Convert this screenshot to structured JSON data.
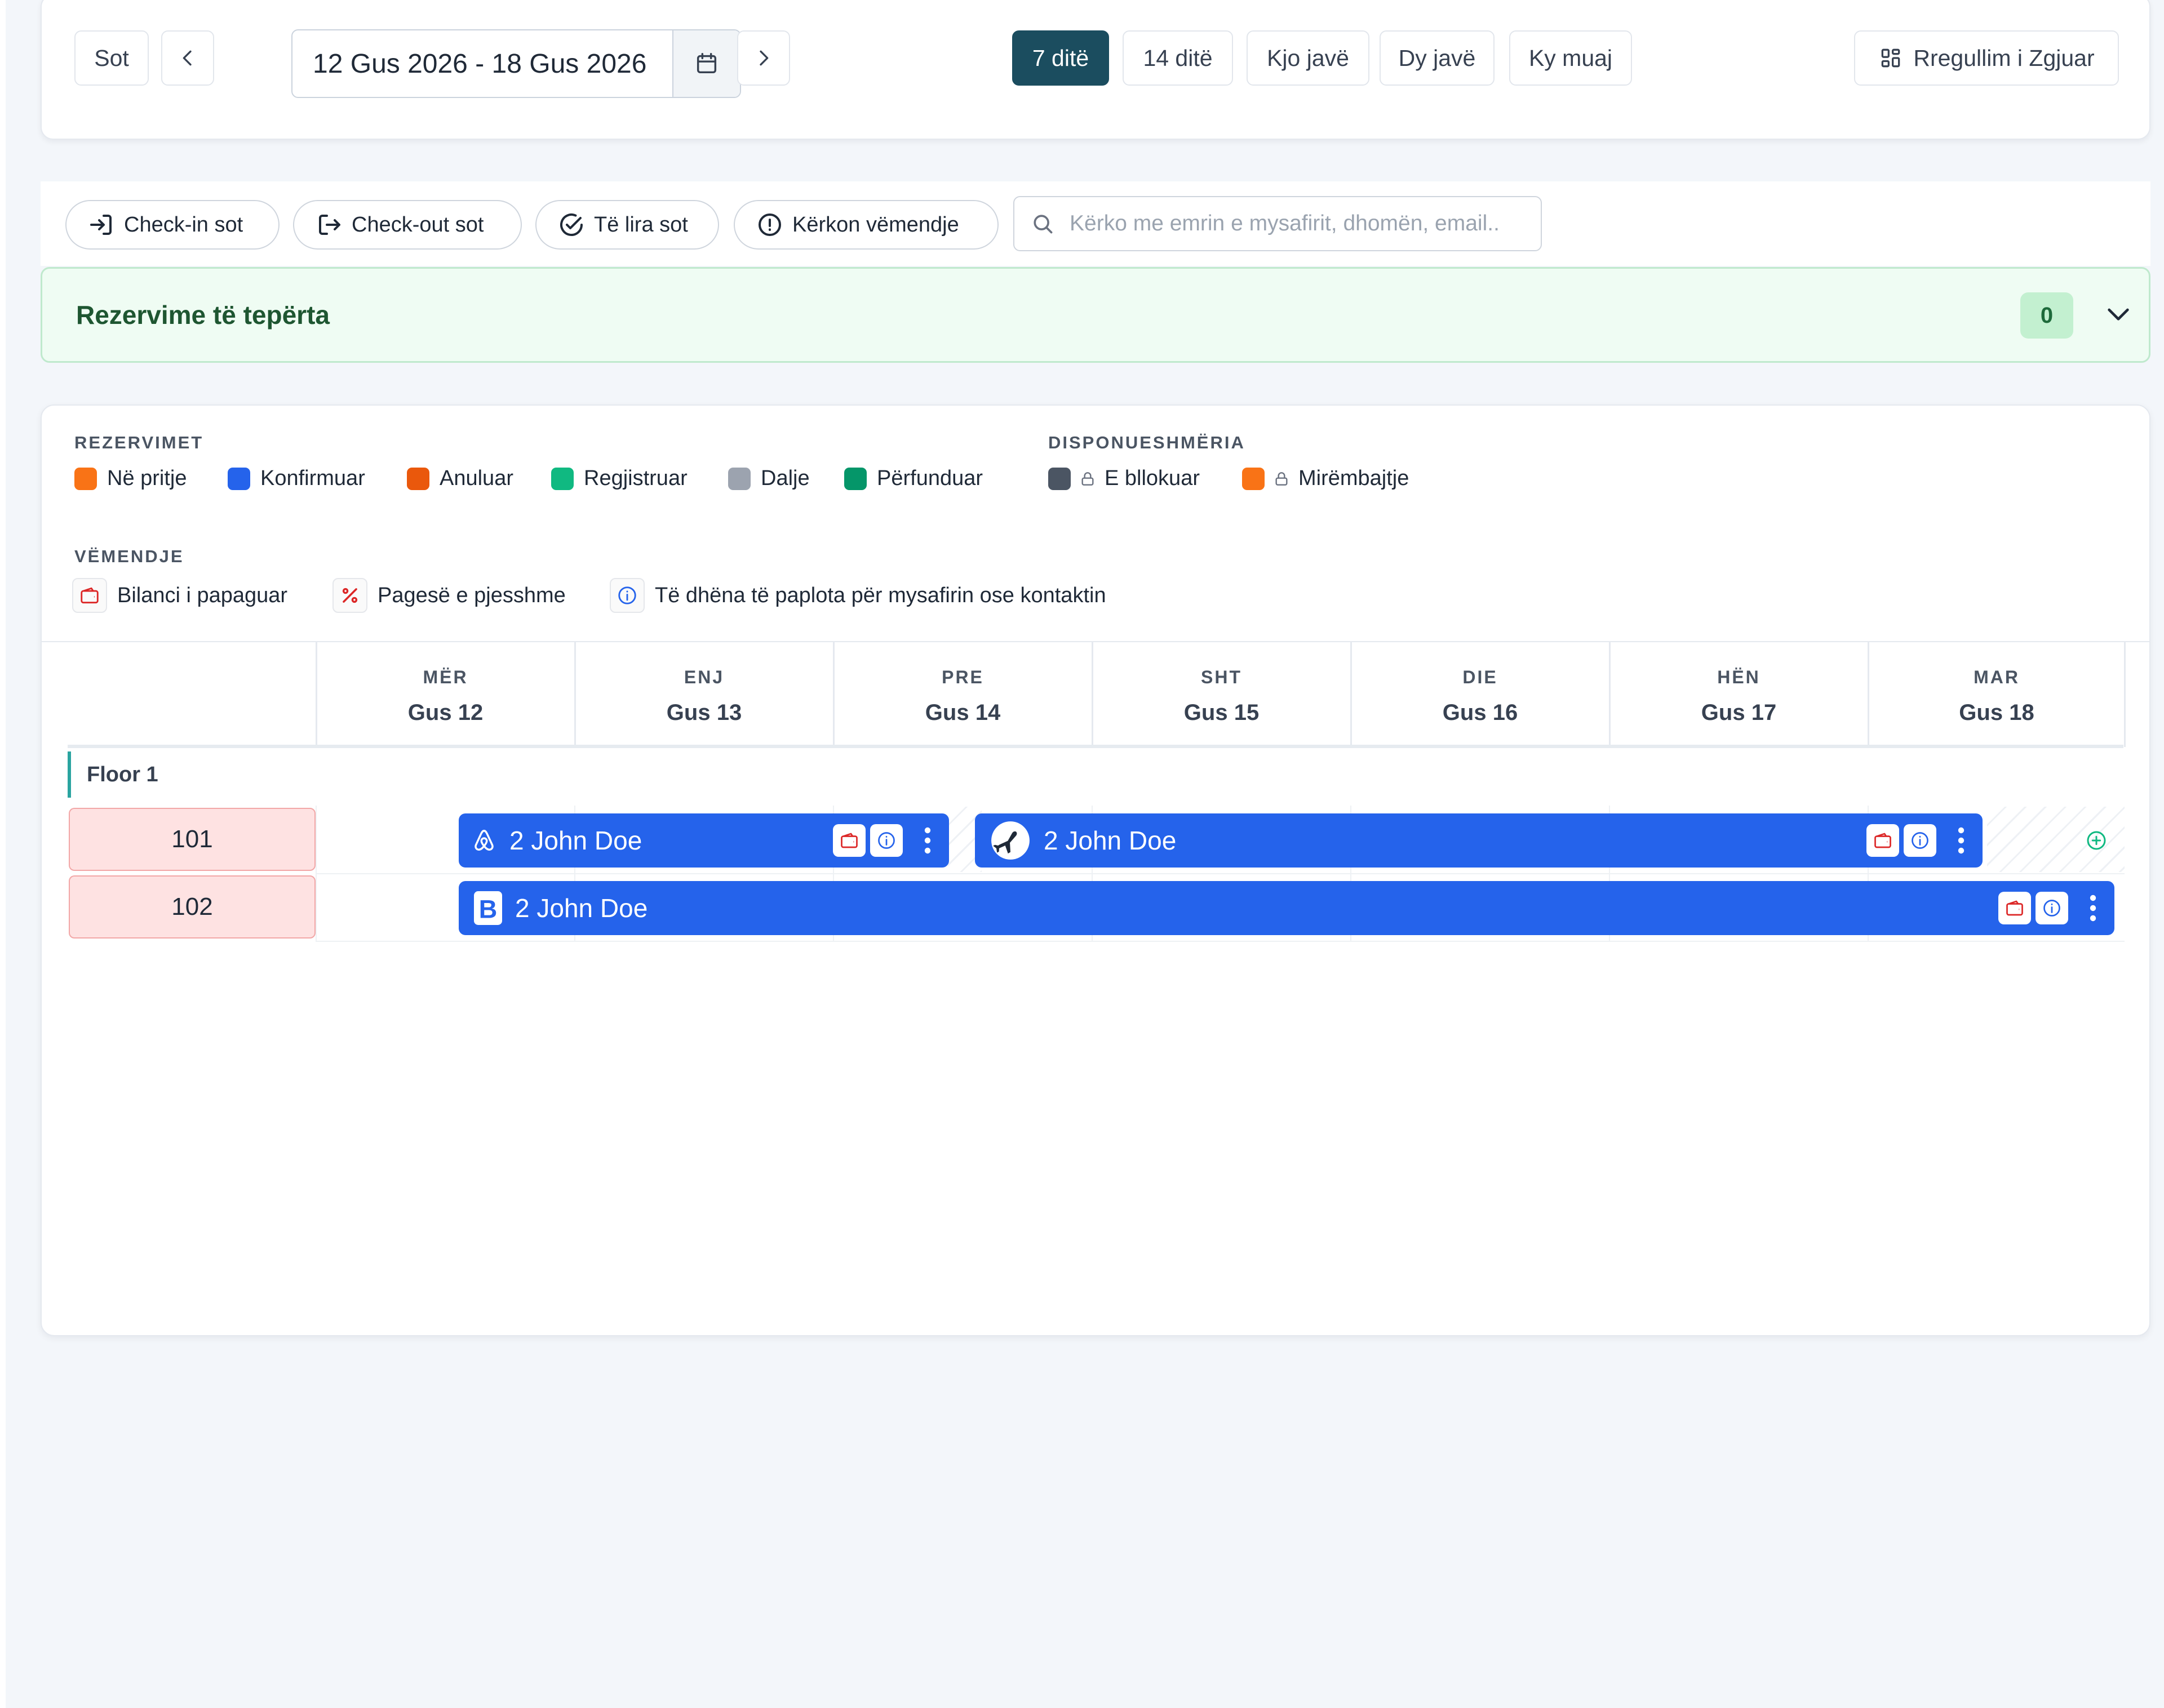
{
  "toolbar": {
    "today_label": "Sot",
    "date_range": "12 Gus 2026 - 18 Gus 2026",
    "view_options": [
      "7 ditë",
      "14 ditë",
      "Kjo javë",
      "Dy javë",
      "Ky muaj"
    ],
    "active_view": "7 ditë",
    "advanced_settings_label": "Rregullim i Zgjuar"
  },
  "filters": {
    "checkin_today": "Check-in sot",
    "checkout_today": "Check-out sot",
    "free_today": "Të lira sot",
    "needs_attention": "Kërkon vëmendje",
    "search_placeholder": "Kërko me emrin e mysafirit, dhomën, email..."
  },
  "overbooking": {
    "title": "Rezervime të tepërta",
    "count": "0"
  },
  "legend": {
    "reservations_title": "REZERVIMET",
    "reservations": [
      {
        "label": "Në pritje",
        "color": "#f97316"
      },
      {
        "label": "Konfirmuar",
        "color": "#2563eb"
      },
      {
        "label": "Anuluar",
        "color": "#ea580c"
      },
      {
        "label": "Regjistruar",
        "color": "#10b981"
      },
      {
        "label": "Dalje",
        "color": "#9ca3af"
      },
      {
        "label": "Përfunduar",
        "color": "#059669"
      }
    ],
    "availability_title": "DISPONUESHMËRIA",
    "availability": [
      {
        "label": "E bllokuar",
        "color": "#4b5563"
      },
      {
        "label": "Mirëmbajtje",
        "color": "#f97316"
      }
    ],
    "alerts_title": "VËMENDJE",
    "alerts": [
      {
        "label": "Bilanci i papaguar",
        "icon": "wallet-icon"
      },
      {
        "label": "Pagesë e pjesshme",
        "icon": "percent-icon"
      },
      {
        "label": "Të dhëna të paplota për mysafirin ose kontaktin",
        "icon": "info-icon"
      }
    ]
  },
  "days": [
    {
      "weekday": "MËR",
      "date": "Gus 12"
    },
    {
      "weekday": "ENJ",
      "date": "Gus 13"
    },
    {
      "weekday": "PRE",
      "date": "Gus 14"
    },
    {
      "weekday": "SHT",
      "date": "Gus 15"
    },
    {
      "weekday": "DIE",
      "date": "Gus 16"
    },
    {
      "weekday": "HËN",
      "date": "Gus 17"
    },
    {
      "weekday": "MAR",
      "date": "Gus 18"
    }
  ],
  "floor": "Floor 1",
  "rooms": [
    "101",
    "102"
  ],
  "bookings": [
    {
      "room": "101",
      "label": "2 John Doe",
      "source_icon": "airbnb-icon",
      "status": "Konfirmuar"
    },
    {
      "room": "101",
      "label": "2 John Doe",
      "source_icon": "plane-icon",
      "status": "Konfirmuar"
    },
    {
      "room": "102",
      "label": "2 John Doe",
      "source_icon": "booking-com-icon",
      "status": "Konfirmuar"
    }
  ],
  "colors": {
    "confirmed": "#2563eb",
    "primary_dark": "#1b4d5f",
    "room_occupied": "#fee2e2",
    "overbook_bg": "#effcf3"
  }
}
